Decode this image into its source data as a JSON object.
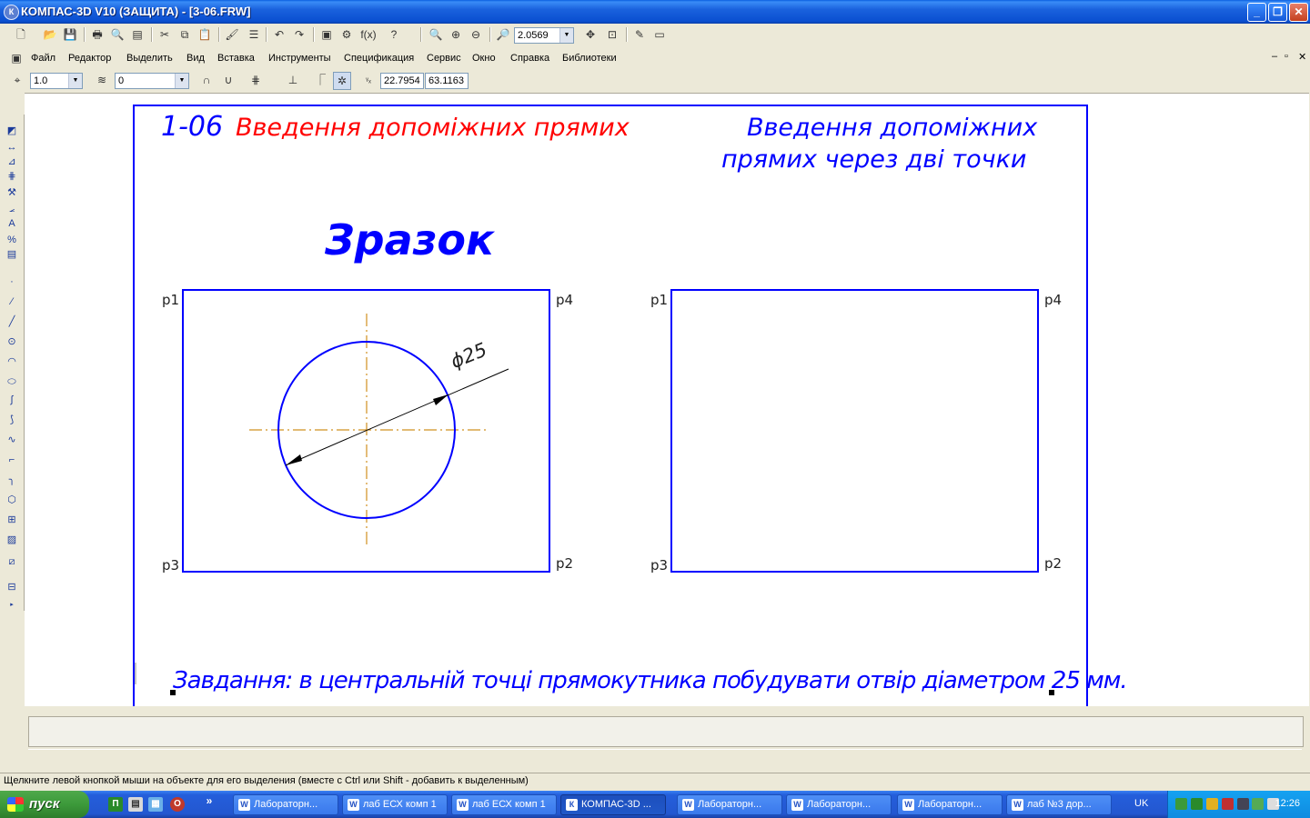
{
  "window": {
    "title": "КОМПАС-3D V10 (ЗАЩИТА) - [3-06.FRW]",
    "app_icon": "К",
    "minimize": "_",
    "restore": "❐",
    "close": "✕"
  },
  "toolbar": {
    "zoom_value": "2.0569"
  },
  "menu": {
    "items": [
      "Файл",
      "Редактор",
      "Выделить",
      "Вид",
      "Вставка",
      "Инструменты",
      "Спецификация",
      "Сервис",
      "Окно",
      "Справка",
      "Библиотеки"
    ],
    "doc_controls": [
      "–",
      "▫",
      "✕"
    ]
  },
  "props_toolbar": {
    "step_value": "1.0",
    "layer_value": "0",
    "coord_x": "22.7954",
    "coord_y": "63.1163"
  },
  "drawing": {
    "header_number": "1-06",
    "header_title": "Введення допоміжних прямих",
    "header_right_line1": "Введення допоміжних",
    "header_right_line2": "прямих через дві точки",
    "sample_label": "Зразок",
    "left_rect_labels": {
      "p1": "p1",
      "p2": "p2",
      "p3": "p3",
      "p4": "p4"
    },
    "right_rect_labels": {
      "p1": "p1",
      "p2": "p2",
      "p3": "p3",
      "p4": "p4"
    },
    "dimension_label": "ϕ25",
    "task_text": "Завдання: в центральній точці прямокутника побудувати отвір діаметром 25 мм.",
    "colors": {
      "frame": "#0000ff",
      "red_text": "#ff0000",
      "axis": "#d09020",
      "dim": "#000000"
    }
  },
  "status": {
    "message": "Щелкните левой кнопкой мыши на объекте для его выделения (вместе с Ctrl или Shift - добавить к выделенным)"
  },
  "taskbar": {
    "start_label": "пуск",
    "tasks": [
      {
        "label": "Лабораторн...",
        "icon": "W"
      },
      {
        "label": "лаб ЕСХ комп 1",
        "icon": "W"
      },
      {
        "label": "лаб ЕСХ комп 1",
        "icon": "W"
      },
      {
        "label": "КОМПАС-3D ...",
        "icon": "К"
      },
      {
        "label": "Лабораторн...",
        "icon": "W"
      },
      {
        "label": "Лабораторн...",
        "icon": "W"
      },
      {
        "label": "Лабораторн...",
        "icon": "W"
      },
      {
        "label": "лаб №3 дор...",
        "icon": "W"
      }
    ],
    "language": "UK",
    "clock": "12:26"
  }
}
